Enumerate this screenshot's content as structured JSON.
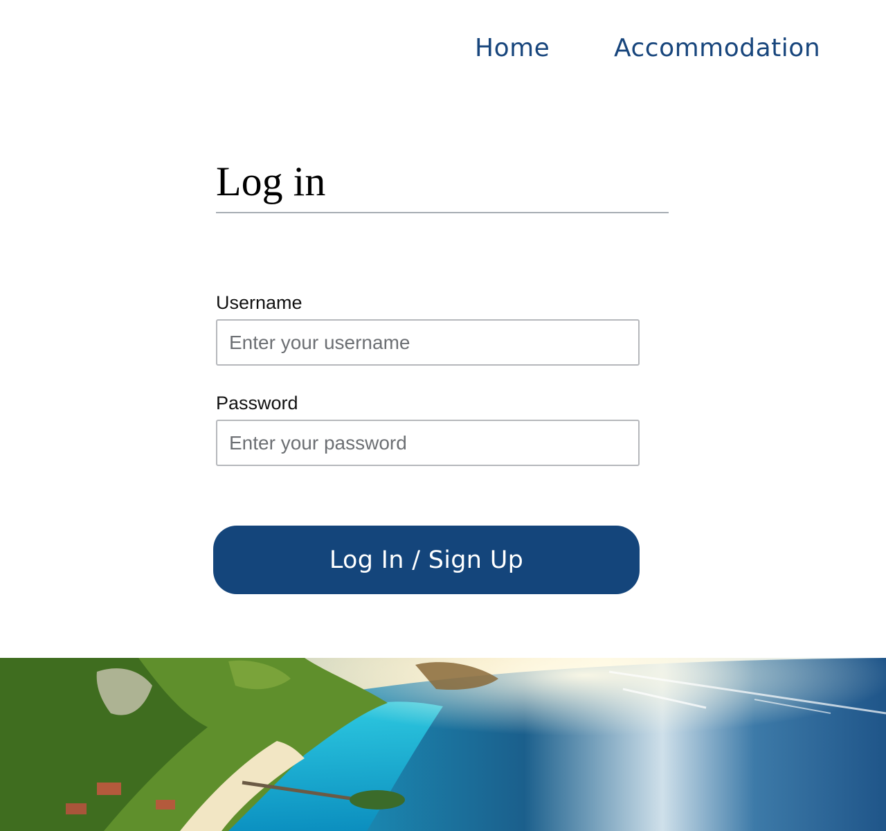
{
  "nav": {
    "home_label": "Home",
    "accommodation_label": "Accommodation"
  },
  "login": {
    "title": "Log in",
    "username_label": "Username",
    "username_placeholder": "Enter your username",
    "password_label": "Password",
    "password_placeholder": "Enter your password",
    "submit_label": "Log In / Sign Up"
  },
  "colors": {
    "brand": "#14457b",
    "nav_text": "#17457c",
    "divider": "#a6acb3"
  }
}
